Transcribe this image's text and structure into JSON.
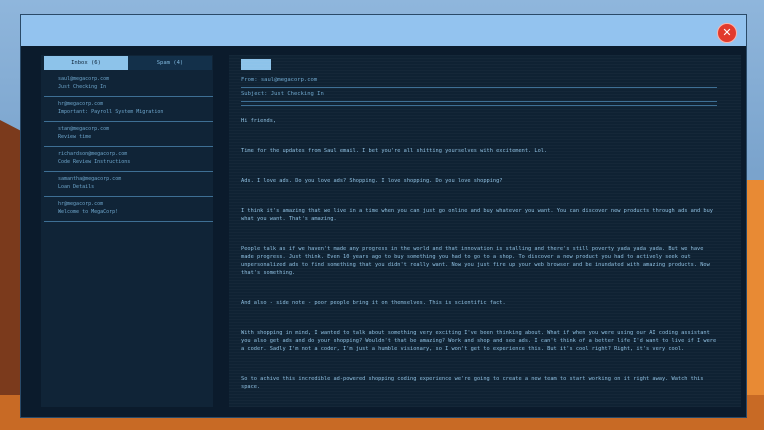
{
  "window": {
    "close_symbol": "✕",
    "close_icon": "close-icon"
  },
  "tabs": [
    {
      "label": "Inbox (6)",
      "active": true
    },
    {
      "label": "Spam (4)",
      "active": false
    }
  ],
  "emails": [
    {
      "from": "saul@megacorp.com",
      "subject": "Just Checking In"
    },
    {
      "from": "hr@megacorp.com",
      "subject": "Important: Payroll System Migration"
    },
    {
      "from": "stan@megacorp.com",
      "subject": "Review time"
    },
    {
      "from": "richardson@megacorp.com",
      "subject": "Code Review Instructions"
    },
    {
      "from": "samantha@megacorp.com",
      "subject": "Loan Details"
    },
    {
      "from": "hr@megacorp.com",
      "subject": "Welcome to MegaCorp!"
    }
  ],
  "message": {
    "from_line": "From:  saul@megacorp.com",
    "subject_line": "Subject: Just Checking In",
    "paragraphs": [
      "Hi friends,",
      "Time for the updates from Saul email. I bet you're all shitting yourselves with excitement. Lol.",
      "Ads. I love ads. Do you love ads? Shopping. I love shopping. Do you love shopping?",
      "I think it's amazing that we live in a time when you can just go online and buy whatever you want. You can discover new products through ads and buy what you want. That's amazing.",
      "People talk as if we haven't made any progress in the world and that innovation is stalling and there's still poverty yada yada yada. But we have made progress. Just think. Even 10 years ago to buy something you had to go to a shop. To discover a new product you had to actively seek out unpersonalized ads to find something that you didn't really want. Now you just fire up your web browser and be inundated with amazing products. Now that's something.",
      "And also - side note - poor people bring it on themselves. This is scientific fact.",
      "With shopping in mind, I wanted to talk about something very exciting I've been thinking about. What if when you were using our AI coding assistant you also get ads and do your shopping? Wouldn't that be amazing? Work and shop and see ads. I can't think of a better life I'd want to live if I were a coder. Sadly I'm not a coder, I'm just a humble visionary, so I won't get to experience this. But it's cool right? Right, it's very cool.",
      "So to achive this incredible ad-powered shopping coding experience we're going to create a new team to start working on it right away. Watch this space."
    ]
  }
}
